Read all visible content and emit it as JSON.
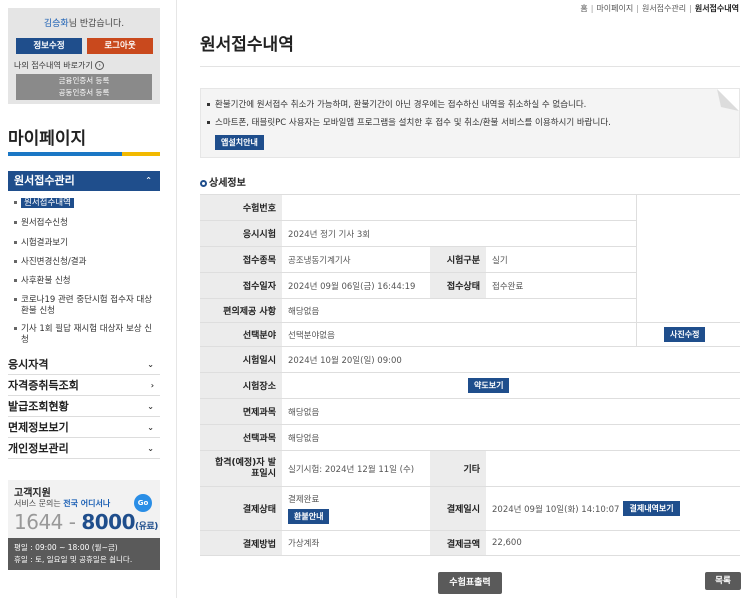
{
  "breadcrumb": [
    "홈",
    "마이페이지",
    "원서접수관리",
    "원서접수내역"
  ],
  "login": {
    "user_name": "김승화",
    "greeting": "님 반갑습니다.",
    "info_btn": "정보수정",
    "logout_btn": "로그아웃",
    "my_app_link": "나의 접수내역 바로가기",
    "cert_line1": "금융인증서 등록",
    "cert_line2": "공동인증서 등록"
  },
  "sidebar": {
    "title": "마이페이지",
    "section": "원서접수관리",
    "sub_items": [
      "원서접수내역",
      "원서접수신청",
      "시험결과보기",
      "사진변경신청/결과",
      "사후환불 신청",
      "코로나19 관련 중단시험 접수자 대상 환불 신청",
      "기사 1회 필답 재시험 대상자 보상 신청"
    ],
    "categories": [
      "응시자격",
      "자격증취득조회",
      "발급조회현황",
      "면제정보보기",
      "개인정보관리"
    ]
  },
  "support": {
    "title": "고객지원",
    "line_prefix": "서비스 문의는 ",
    "line_bold": "전국 어디서나",
    "go": "Go",
    "phone1": "1644 - ",
    "phone2": "8000",
    "phone_note": "(유료)",
    "hours1": "평일 : 09:00 ~ 18:00 (월~금)",
    "hours2": "휴일 : 토, 일요일 및 공휴일은 쉽니다."
  },
  "main": {
    "title": "원서접수내역",
    "notices": [
      "환불기간에 원서접수 취소가 가능하며, 환불기간이 아닌 경우에는 접수하신 내역을 취소하실 수 없습니다.",
      "스마트폰, 태블릿PC 사용자는 모바일앱 프로그램을 설치한 후 접수 및 취소/환불 서비스를 이용하시기 바랍니다."
    ],
    "app_guide_btn": "앱설치안내",
    "detail_title": "상세정보"
  },
  "table": {
    "exam_no_label": "수험번호",
    "exam_no": "",
    "exam_label": "응시시험",
    "exam": "2024년 정기 기사 3회",
    "field_label": "접수종목",
    "field": "공조냉동기계기사",
    "type_label": "시험구분",
    "type": "실기",
    "date_label": "접수일자",
    "date": "2024년 09월 06일(금) 16:44:19",
    "status_label": "접수상태",
    "status": "접수완료",
    "conv_label": "편의제공 사항",
    "conv": "해당없음",
    "sel_label": "선택분야",
    "sel": "선택분야없음",
    "photo_btn": "사진수정",
    "exam_dt_label": "시험일시",
    "exam_dt": "2024년 10월 20일(일) 09:00",
    "place_label": "시험장소",
    "place": "",
    "map_btn": "약도보기",
    "exempt_label": "면제과목",
    "exempt": "해당없음",
    "choice_label": "선택과목",
    "choice": "해당없음",
    "pass_label_1": "합격(예정)자 발",
    "pass_label_2": "표일시",
    "pass": "실기시험: 2024년 12월 11일 (수)",
    "etc_label": "기타",
    "etc": "",
    "pay_status_label": "결제상태",
    "pay_status": "결제완료",
    "refund_btn": "환불안내",
    "pay_dt_label": "결제일시",
    "pay_dt": "2024년 09월 10일(화) 14:10:07",
    "pay_detail_btn": "결제내역보기",
    "pay_method_label": "결제방법",
    "pay_method": "가상계좌",
    "pay_amt_label": "결제금액",
    "pay_amt": "22,600"
  },
  "buttons": {
    "print": "수험표출력",
    "list": "목록"
  }
}
